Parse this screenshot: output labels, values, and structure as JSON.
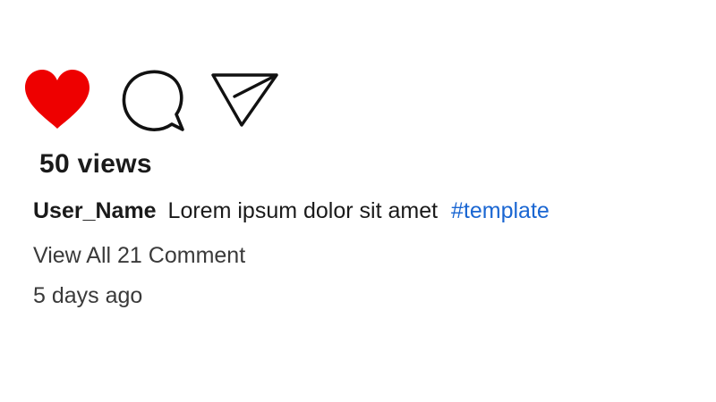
{
  "post": {
    "views": "50 views",
    "username": "User_Name",
    "caption": "Lorem ipsum dolor sit amet",
    "hashtag": "#template",
    "view_comments": "View All 21 Comment",
    "timestamp": "5 days ago"
  },
  "icons": {
    "like": "heart-icon",
    "comment": "speech-bubble-icon",
    "share": "paper-plane-icon"
  },
  "colors": {
    "like_active": "#ee0000",
    "hashtag": "#1a66d2",
    "text": "#1a1a1a",
    "secondary_text": "#3a3a3a"
  },
  "state": {
    "liked": true
  }
}
